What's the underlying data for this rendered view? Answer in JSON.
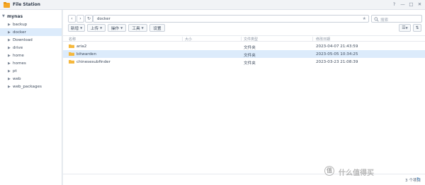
{
  "app": {
    "title": "File Station"
  },
  "window_controls": {
    "help": "?",
    "minimize": "—",
    "maximize": "□",
    "close": "✕"
  },
  "sidebar": {
    "root": "mynas",
    "items": [
      {
        "label": "backup",
        "active": false
      },
      {
        "label": "docker",
        "active": true
      },
      {
        "label": "Download",
        "active": false
      },
      {
        "label": "drive",
        "active": false
      },
      {
        "label": "home",
        "active": false
      },
      {
        "label": "homes",
        "active": false
      },
      {
        "label": "pt",
        "active": false
      },
      {
        "label": "web",
        "active": false
      },
      {
        "label": "web_packages",
        "active": false
      }
    ]
  },
  "nav": {
    "back": "‹",
    "forward": "›",
    "refresh": "↻"
  },
  "path": {
    "value": "docker",
    "favorite_icon": "★"
  },
  "search": {
    "placeholder": "搜索"
  },
  "toolbar": {
    "new": "新增",
    "upload": "上传",
    "action": "操作",
    "tools": "工具",
    "settings": "设置"
  },
  "table": {
    "headers": {
      "name": "名称",
      "size": "大小",
      "type": "文件类型",
      "modified": "修改日期"
    },
    "rows": [
      {
        "name": "aria2",
        "size": "",
        "type": "文件夹",
        "modified": "2023-04-07 21:43:59",
        "selected": false
      },
      {
        "name": "bitwarden",
        "size": "",
        "type": "文件夹",
        "modified": "2023-05-05 10:34:25",
        "selected": true
      },
      {
        "name": "chinesesubfinder",
        "size": "",
        "type": "文件夹",
        "modified": "2023-03-23 21:08:39",
        "selected": false
      }
    ]
  },
  "status": {
    "count": "3 个项目"
  },
  "watermark": {
    "badge": "值",
    "text": "什么值得买"
  },
  "colors": {
    "accent": "#3b82c4",
    "selected_row": "#dcebfb",
    "folder": "#f5b83d"
  }
}
